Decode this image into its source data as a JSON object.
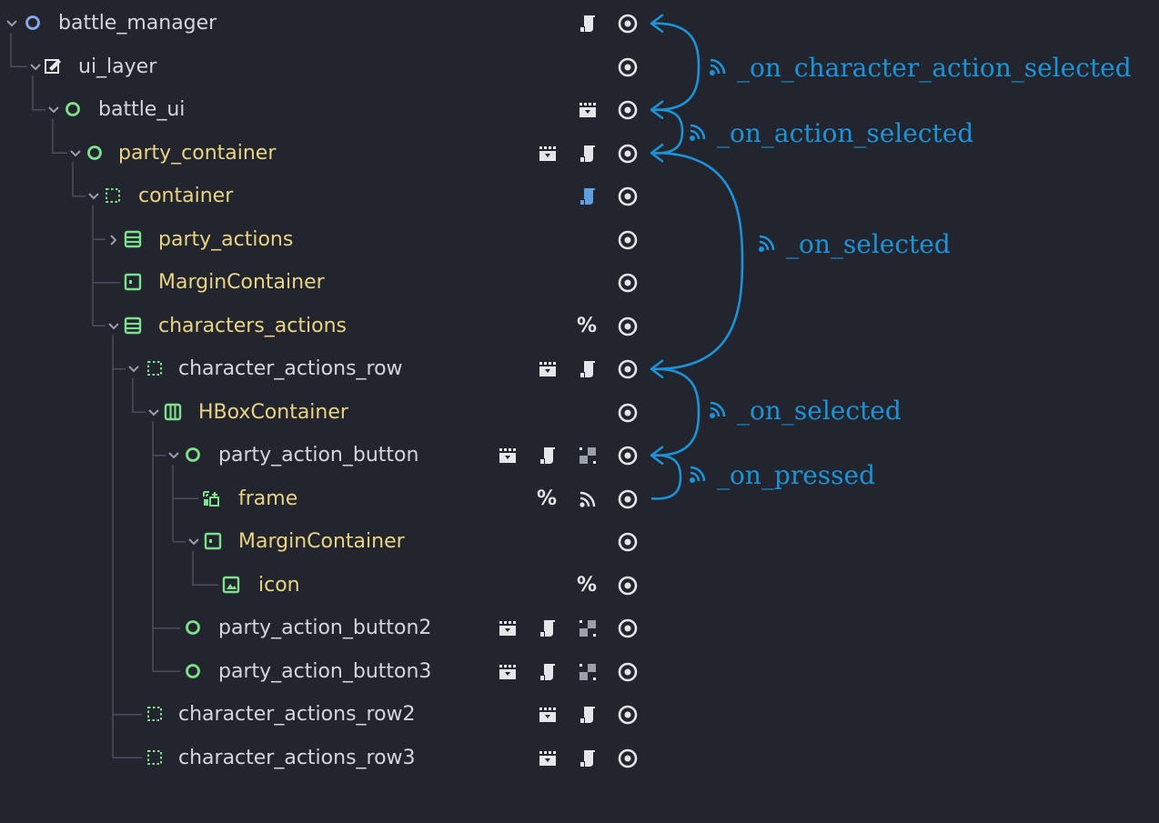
{
  "colors": {
    "background": "#22252d",
    "tree_line": "#4a4e58",
    "label_white": "#d4d6dc",
    "label_yellow": "#e8d482",
    "node_green": "#7fe08d",
    "node_blue": "#8ea8f0",
    "connection": "#1c93d8",
    "icon_light": "#e4e6ea",
    "script_blue": "#5fa0e0"
  },
  "tree": {
    "nodes": [
      {
        "name": "battle_manager",
        "icon": "node-circle-icon",
        "icon_color": "blue",
        "badges": [
          "script-icon",
          "visibility-icon"
        ]
      },
      {
        "name": "ui_layer",
        "icon": "canvas-layer-icon",
        "icon_color": "white",
        "badges": [
          "visibility-icon"
        ]
      },
      {
        "name": "battle_ui",
        "icon": "node-circle-icon",
        "icon_color": "green",
        "badges": [
          "scene-clapper-icon",
          "visibility-icon"
        ]
      },
      {
        "name": "party_container",
        "icon": "node-circle-icon",
        "icon_color": "green",
        "badges": [
          "scene-clapper-icon",
          "script-icon",
          "visibility-icon"
        ]
      },
      {
        "name": "container",
        "icon": "container-icon",
        "icon_color": "green",
        "badges": [
          "script-blue-icon",
          "visibility-icon"
        ]
      },
      {
        "name": "party_actions",
        "icon": "vbox-icon",
        "icon_color": "green",
        "badges": [
          "visibility-icon"
        ]
      },
      {
        "name": "MarginContainer",
        "icon": "margin-container-icon",
        "icon_color": "green",
        "badges": [
          "visibility-icon"
        ]
      },
      {
        "name": "characters_actions",
        "icon": "vbox-icon",
        "icon_color": "green",
        "badges": [
          "unique-name-icon",
          "visibility-icon"
        ]
      },
      {
        "name": "character_actions_row",
        "icon": "container-icon",
        "icon_color": "green",
        "badges": [
          "scene-clapper-icon",
          "script-icon",
          "visibility-icon"
        ]
      },
      {
        "name": "HBoxContainer",
        "icon": "hbox-icon",
        "icon_color": "green",
        "badges": [
          "visibility-icon"
        ]
      },
      {
        "name": "party_action_button",
        "icon": "node-circle-icon",
        "icon_color": "green",
        "badges": [
          "scene-clapper-icon",
          "script-icon",
          "group-icon",
          "visibility-icon"
        ]
      },
      {
        "name": "frame",
        "icon": "nine-patch-icon",
        "icon_color": "green",
        "badges": [
          "unique-name-icon",
          "signal-icon",
          "visibility-icon"
        ]
      },
      {
        "name": "MarginContainer",
        "icon": "margin-container-icon",
        "icon_color": "green",
        "badges": [
          "visibility-icon"
        ]
      },
      {
        "name": "icon",
        "icon": "texture-rect-icon",
        "icon_color": "green",
        "badges": [
          "unique-name-icon",
          "visibility-icon"
        ]
      },
      {
        "name": "party_action_button2",
        "icon": "node-circle-icon",
        "icon_color": "green",
        "badges": [
          "scene-clapper-icon",
          "script-icon",
          "group-icon",
          "visibility-icon"
        ]
      },
      {
        "name": "party_action_button3",
        "icon": "node-circle-icon",
        "icon_color": "green",
        "badges": [
          "scene-clapper-icon",
          "script-icon",
          "group-icon",
          "visibility-icon"
        ]
      },
      {
        "name": "character_actions_row2",
        "icon": "container-icon",
        "icon_color": "green",
        "badges": [
          "scene-clapper-icon",
          "script-icon",
          "visibility-icon"
        ]
      },
      {
        "name": "character_actions_row3",
        "icon": "container-icon",
        "icon_color": "green",
        "badges": [
          "scene-clapper-icon",
          "script-icon",
          "visibility-icon"
        ]
      }
    ],
    "unique_name_symbol": "%"
  },
  "signals": [
    {
      "label": "_on_character_action_selected",
      "icon": "signal-icon"
    },
    {
      "label": "_on_action_selected",
      "icon": "signal-icon"
    },
    {
      "label": "_on_selected",
      "icon": "signal-icon"
    },
    {
      "label": "_on_selected",
      "icon": "signal-icon"
    },
    {
      "label": "_on_pressed",
      "icon": "signal-icon"
    }
  ]
}
